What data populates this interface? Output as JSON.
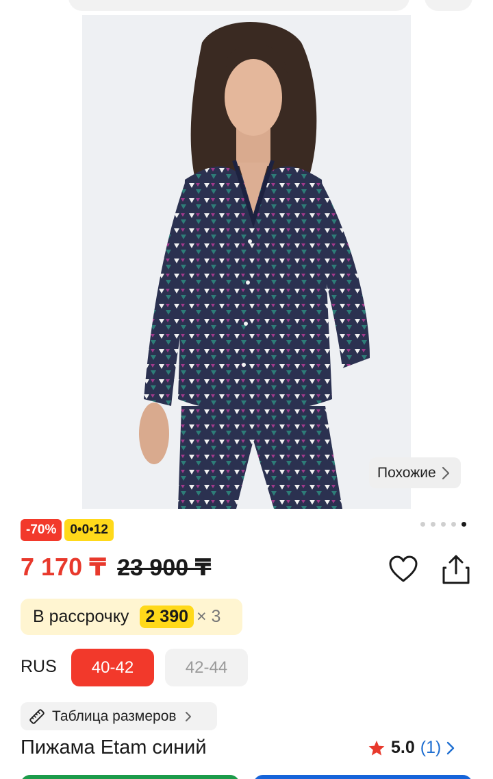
{
  "product": {
    "image_alt": "product-photo",
    "similar_label": "Похожие",
    "gallery": {
      "count": 5,
      "active_index": 4
    },
    "discount_badge": "-70%",
    "installment_badge": "0•0•12",
    "price_current": "7 170 ₸",
    "price_old": "23 900 ₸",
    "installment": {
      "label": "В рассрочку",
      "amount": "2 390",
      "times": "× 3"
    },
    "size_system": "RUS",
    "sizes": [
      {
        "label": "40-42",
        "selected": true
      },
      {
        "label": "42-44",
        "selected": false
      }
    ],
    "size_table_label": "Таблица размеров",
    "title": "Пижама Etam синий",
    "rating": {
      "score": "5.0",
      "count": "(1)"
    }
  },
  "colors": {
    "accent_red": "#f2392b",
    "badge_yellow": "#ffd91a",
    "installment_bg": "#fff5d1",
    "link_blue": "#1f6fd1",
    "button_green": "#1c9b4a",
    "button_blue": "#1664d9"
  },
  "icons": [
    "chevron-right-icon",
    "heart-icon",
    "share-icon",
    "ruler-icon",
    "star-icon"
  ]
}
